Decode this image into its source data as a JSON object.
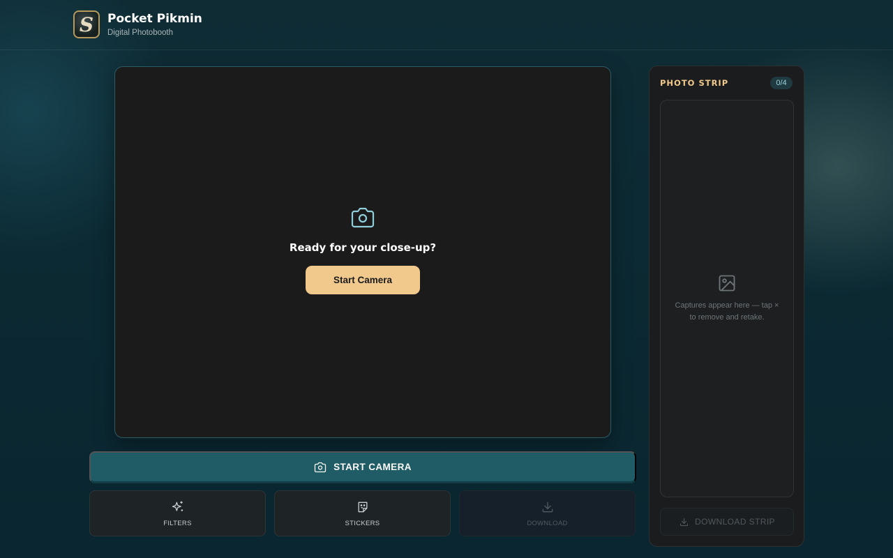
{
  "header": {
    "title": "Pocket Pikmin",
    "subtitle": "Digital Photobooth",
    "logo_letter": "S"
  },
  "viewport": {
    "icon": "camera-icon",
    "prompt": "Ready for your close-up?",
    "start_label": "Start Camera"
  },
  "controls": {
    "start_camera_label": "START CAMERA",
    "tools": [
      {
        "label": "FILTERS",
        "icon": "sparkles-icon",
        "enabled": true
      },
      {
        "label": "STICKERS",
        "icon": "sticker-icon",
        "enabled": true
      },
      {
        "label": "DOWNLOAD",
        "icon": "download-icon",
        "enabled": false
      }
    ]
  },
  "strip": {
    "title": "PHOTO STRIP",
    "count": "0/4",
    "empty_icon": "image-icon",
    "hint": "Captures appear here — tap × to remove and retake.",
    "download_label": "DOWNLOAD STRIP",
    "download_enabled": false
  },
  "colors": {
    "accent": "#f1c98d",
    "primary_button": "#1f5c66",
    "background": "#0c2a33",
    "camera_icon": "#8fcfdc"
  }
}
